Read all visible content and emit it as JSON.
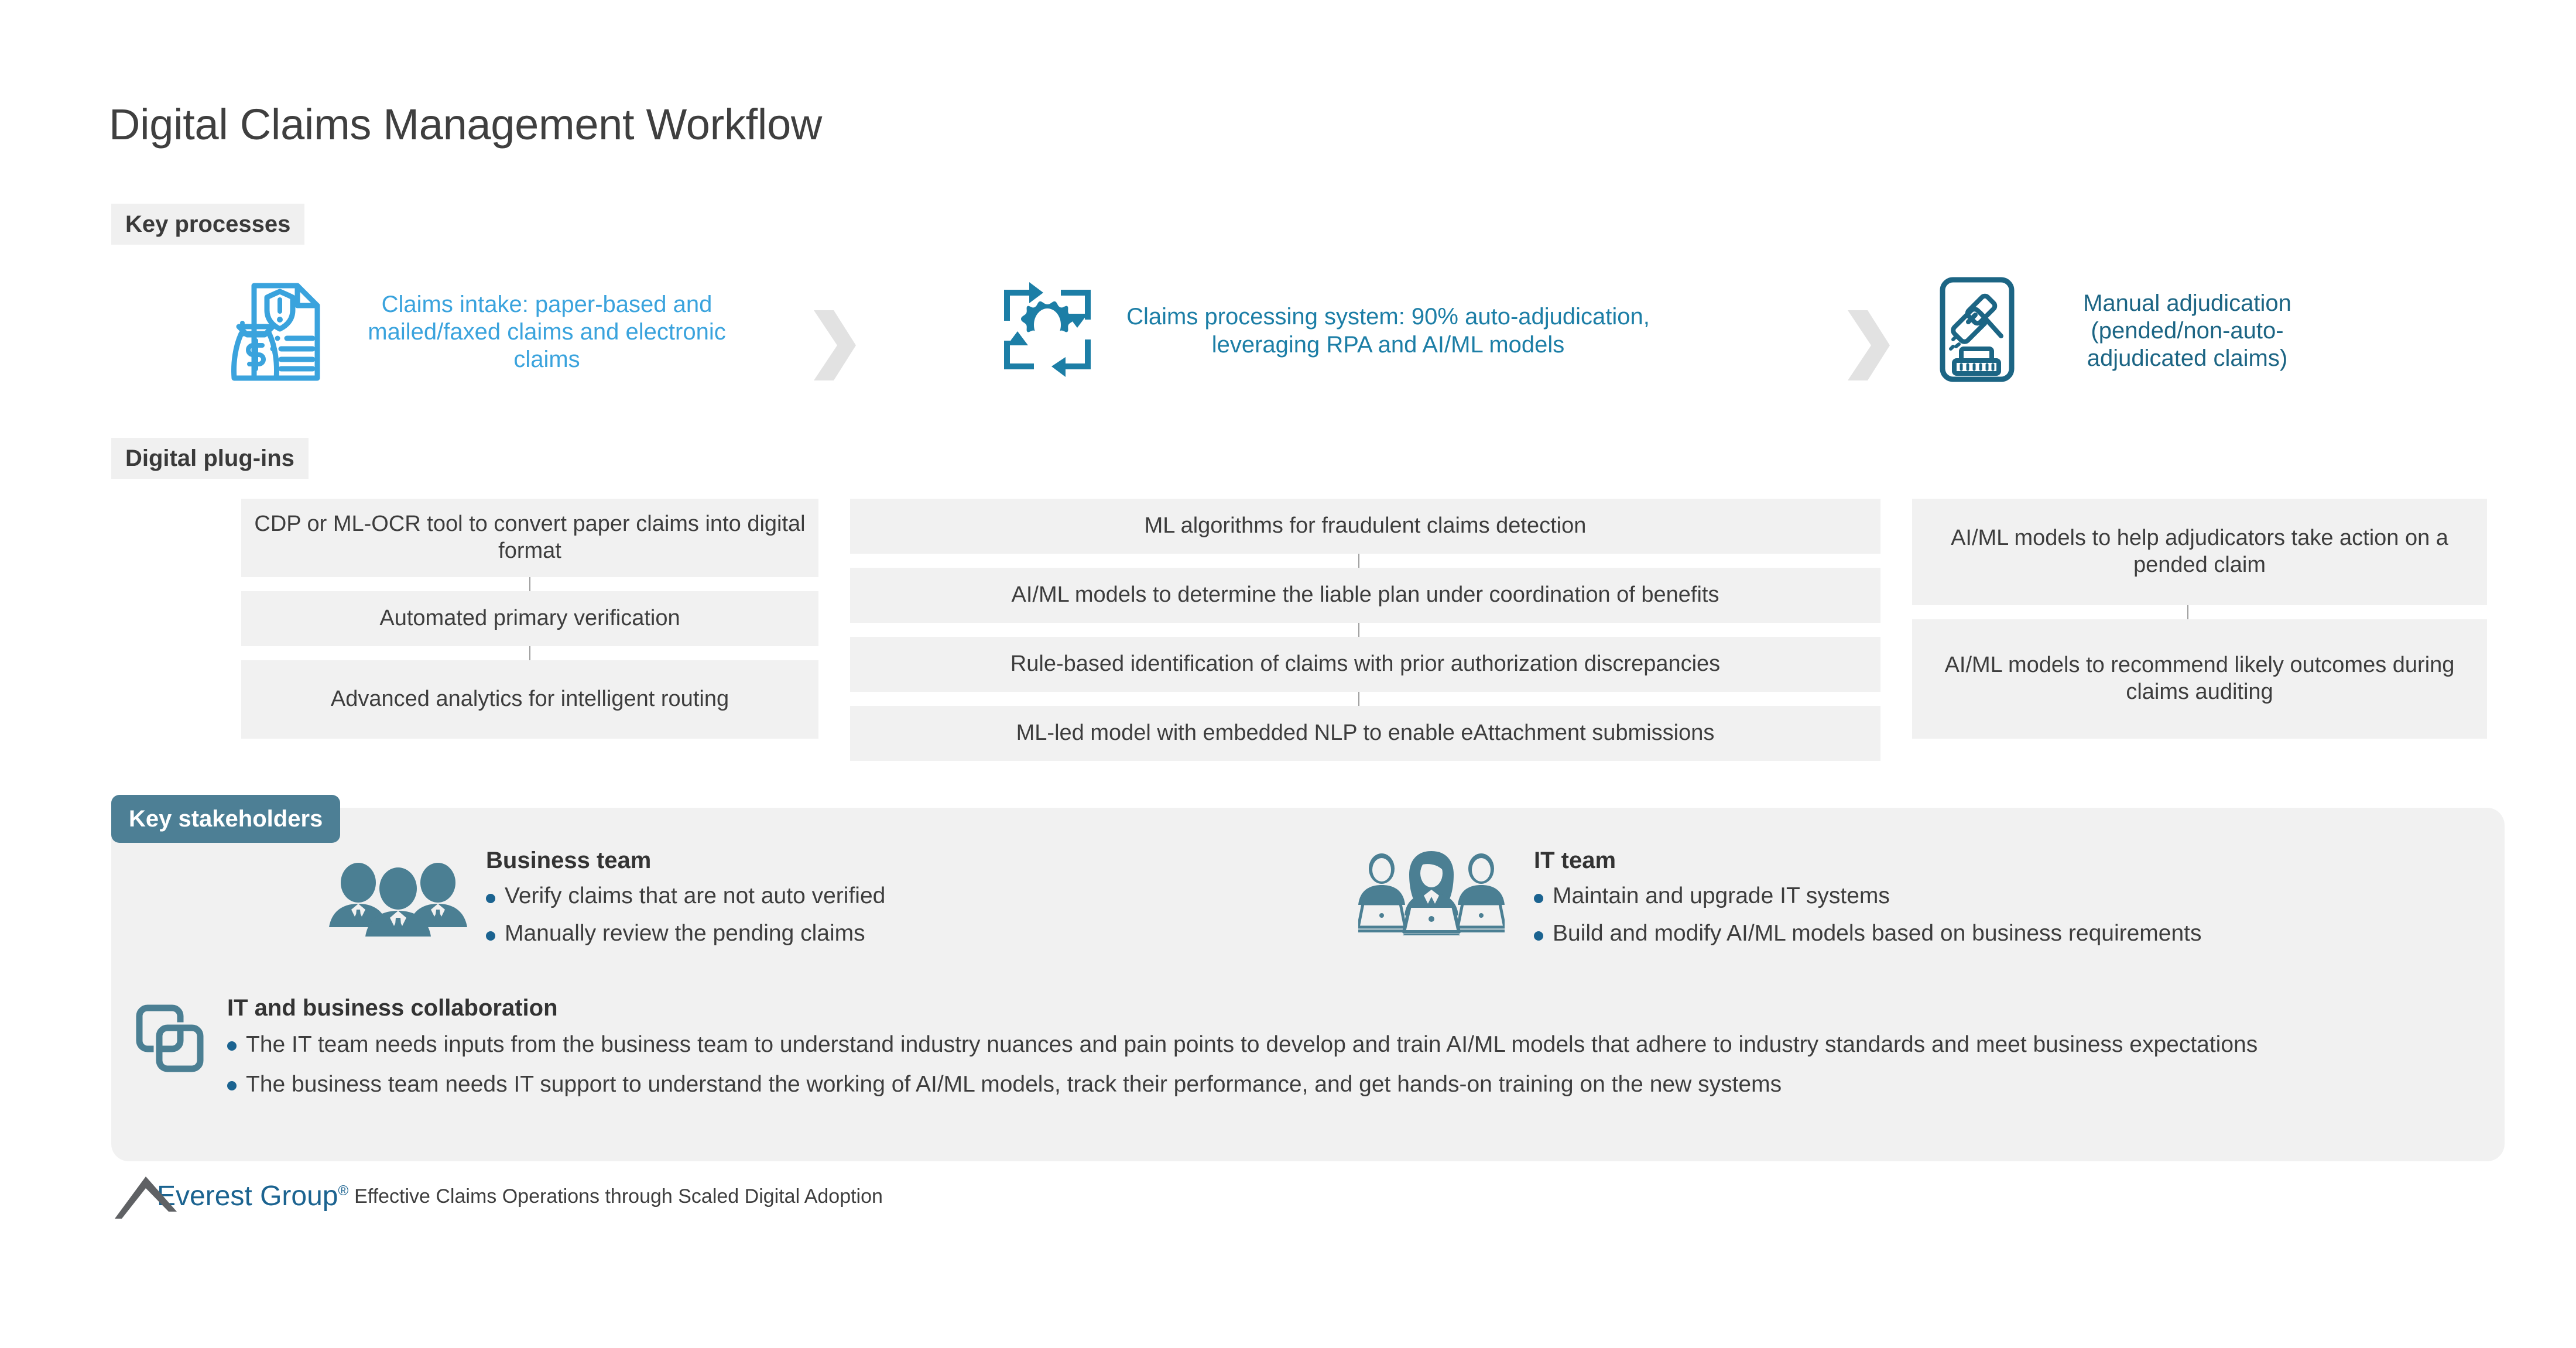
{
  "title": "Digital Claims Management Workflow",
  "sections": {
    "key_processes_label": "Key processes",
    "digital_plugins_label": "Digital plug-ins",
    "key_stakeholders_label": "Key stakeholders"
  },
  "colors": {
    "process_1": "#3aa3dd",
    "process_2": "#1c7ea6",
    "process_3": "#1c6584",
    "chip_bg": "#f0f0f0",
    "stakeholder_chip_bg": "#4d7f95",
    "panel_bg": "#f1f1f1",
    "box_bg": "#f1f1f1",
    "chevron": "#e2e2e2",
    "bullet": "#1b6390",
    "brand_blue": "#1b6390",
    "logo_mark_gray": "#5f6164"
  },
  "processes": [
    {
      "id": "claims-intake",
      "icon": "claim-document-money-icon",
      "text": "Claims intake: paper-based and mailed/faxed claims and electronic claims"
    },
    {
      "id": "claims-processing",
      "icon": "gear-automation-cycle-icon",
      "text": "Claims processing system: 90% auto-adjudication, leveraging RPA and AI/ML models"
    },
    {
      "id": "manual-adjudication",
      "icon": "gavel-icon",
      "text": "Manual adjudication (pended/non-auto-adjudicated claims)"
    }
  ],
  "plugins": {
    "column_1": [
      "CDP or ML-OCR tool to convert paper claims into digital format",
      "Automated primary verification",
      "Advanced analytics for intelligent routing"
    ],
    "column_2": [
      "ML algorithms for fraudulent claims detection",
      "AI/ML models to determine the liable plan under coordination of benefits",
      "Rule-based identification of claims with prior authorization discrepancies",
      "ML-led model with embedded NLP to enable eAttachment submissions"
    ],
    "column_3": [
      "AI/ML models to help adjudicators take action on a pended claim",
      "AI/ML models to recommend likely outcomes during claims auditing"
    ]
  },
  "stakeholders": {
    "business_team": {
      "title": "Business team",
      "icon": "business-people-group-icon",
      "bullets": [
        "Verify claims that are not auto verified",
        "Manually review the pending claims"
      ]
    },
    "it_team": {
      "title": "IT team",
      "icon": "it-people-laptops-icon",
      "bullets": [
        "Maintain and upgrade IT systems",
        "Build and modify AI/ML models based on business requirements"
      ]
    },
    "collaboration": {
      "title": "IT and business collaboration",
      "icon": "overlapping-squares-collaboration-icon",
      "bullets": [
        "The IT team needs inputs from the business team to understand industry nuances and pain points to develop and train AI/ML models that adhere to industry standards and meet business expectations",
        "The business team needs IT support to understand the working of AI/ML models, track their performance, and get hands-on training on the new systems"
      ]
    }
  },
  "footer": {
    "brand": "Everest Group",
    "registered_mark": "®",
    "tagline": "Effective Claims Operations through Scaled Digital Adoption"
  }
}
